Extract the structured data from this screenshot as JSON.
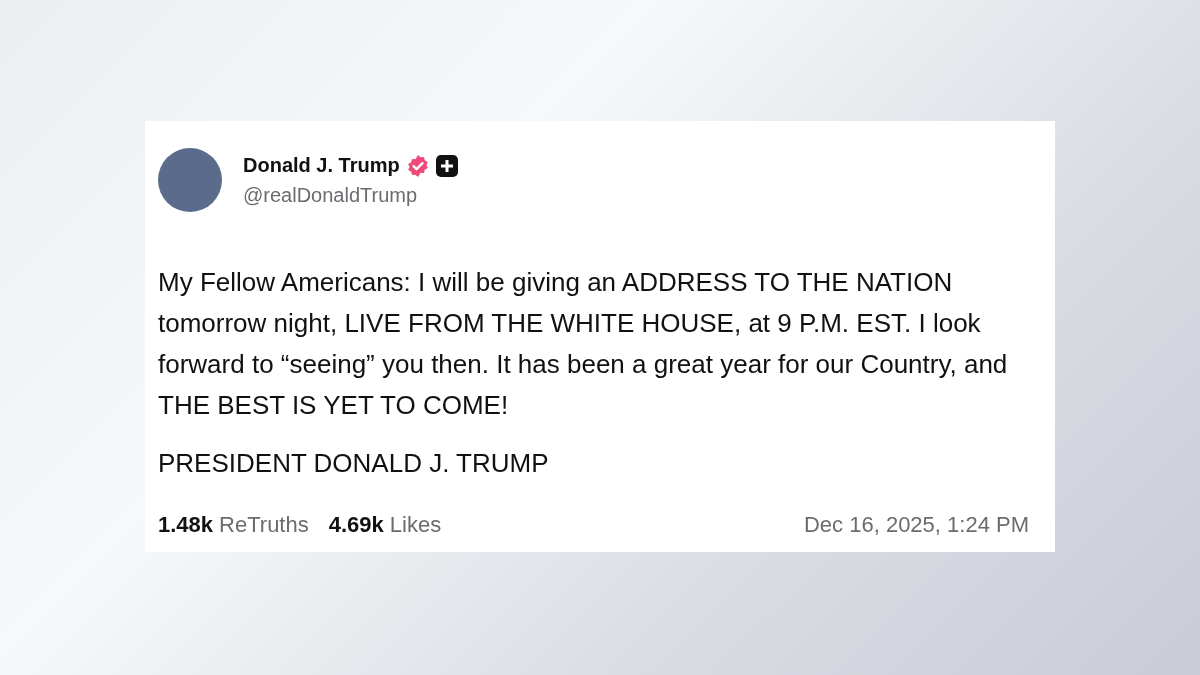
{
  "post": {
    "author": {
      "name": "Donald J. Trump",
      "handle": "@realDonaldTrump",
      "verified": true,
      "plus_badge": true
    },
    "body": "My Fellow Americans: I will be giving an ADDRESS TO THE NATION tomorrow night, LIVE FROM THE WHITE HOUSE, at 9 P.M. EST. I look forward to “seeing” you then. It has been a great year for our Country, and THE BEST IS YET TO COME!",
    "signature": "PRESIDENT DONALD J. TRUMP",
    "stats": [
      {
        "count": "1.48k",
        "label": "ReTruths"
      },
      {
        "count": "4.69k",
        "label": "Likes"
      }
    ],
    "timestamp": "Dec 16, 2025, 1:24 PM"
  }
}
